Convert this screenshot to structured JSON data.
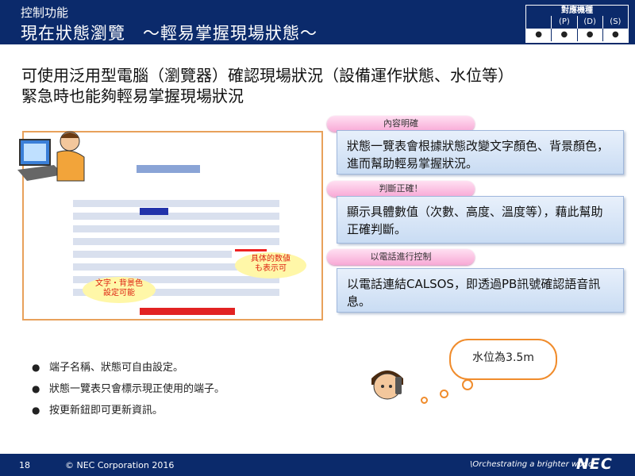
{
  "header": {
    "subtitle": "控制功能",
    "title": "現在狀態瀏覽　～輕易掌握現場狀態～",
    "compat_table": {
      "heading": "對應機種",
      "labels": [
        "",
        "(P)",
        "(D)",
        "(S)"
      ],
      "marks": [
        "●",
        "●",
        "●",
        "●"
      ]
    }
  },
  "headline": {
    "line1": "可使用泛用型電腦（瀏覽器）確認現場狀況（設備運作狀態、水位等）",
    "line2": "緊急時也能夠輕易掌握現場狀況"
  },
  "screenshot": {
    "callout_color": "文字・背景色\n設定可能",
    "callout_value": "具体的数値\nも表示可"
  },
  "features": [
    {
      "tag": "內容明確",
      "text": "狀態一覽表會根據狀態改變文字顏色、背景顏色，進而幫助輕易掌握狀況。"
    },
    {
      "tag": "判斷正確！",
      "text": "顯示具體數值（次數、高度、溫度等），藉此幫助正確判斷。"
    },
    {
      "tag": "以電話進行控制",
      "text": "以電話連結CALSOS，即透過PB訊號確認語音訊息。"
    }
  ],
  "bullets": [
    "端子名稱、狀態可自由設定。",
    "狀態一覽表只會標示現正使用的端子。",
    "按更新鈕即可更新資訊。"
  ],
  "speech": "水位為3.5m",
  "footer": {
    "page": "18",
    "copyright": "© NEC Corporation 2016",
    "tagline": "\\Orchestrating a brighter world",
    "logo": "NEC"
  },
  "colors": {
    "navy": "#0b2a6b",
    "orange": "#f08c2c",
    "pink": "#f8a9d6",
    "box": "#c9dcf3"
  }
}
